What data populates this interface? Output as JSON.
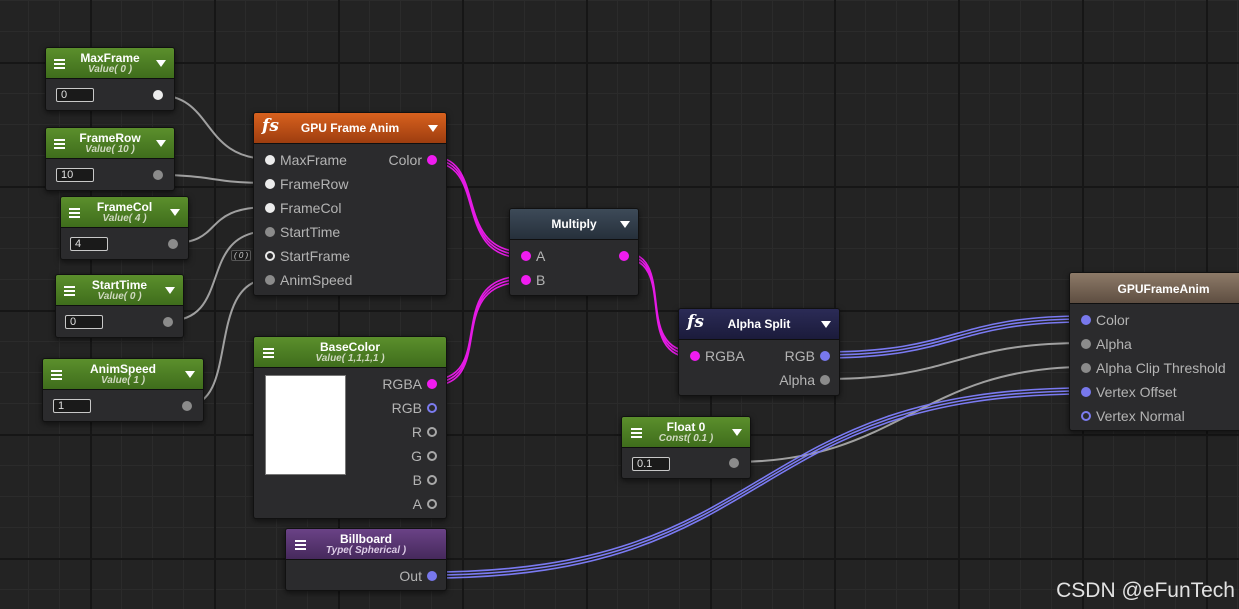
{
  "nodes": {
    "maxframe": {
      "title": "MaxFrame",
      "subtitle": "Value( 0 )",
      "value": "0"
    },
    "framerow": {
      "title": "FrameRow",
      "subtitle": "Value( 10 )",
      "value": "10"
    },
    "framecol": {
      "title": "FrameCol",
      "subtitle": "Value( 4 )",
      "value": "4"
    },
    "starttime": {
      "title": "StartTime",
      "subtitle": "Value( 0 )",
      "value": "0"
    },
    "animspeed": {
      "title": "AnimSpeed",
      "subtitle": "Value( 1 )",
      "value": "1"
    },
    "gpu_frame_anim": {
      "title": "GPU Frame Anim",
      "inputs": [
        "MaxFrame",
        "FrameRow",
        "FrameCol",
        "StartTime",
        "StartFrame",
        "AnimSpeed"
      ],
      "output": "Color",
      "startframe_default": "( 0 )"
    },
    "basecolor": {
      "title": "BaseColor",
      "subtitle": "Value( 1,1,1,1 )",
      "outputs": [
        "RGBA",
        "RGB",
        "R",
        "G",
        "B",
        "A"
      ]
    },
    "multiply": {
      "title": "Multiply",
      "inputs": [
        "A",
        "B"
      ]
    },
    "alpha_split": {
      "title": "Alpha Split",
      "input": "RGBA",
      "outputs": [
        "RGB",
        "Alpha"
      ]
    },
    "float0": {
      "title": "Float 0",
      "subtitle": "Const( 0.1 )",
      "value": "0.1"
    },
    "billboard": {
      "title": "Billboard",
      "subtitle": "Type( Spherical )",
      "output": "Out"
    },
    "output": {
      "title": "GPUFrameAnim",
      "inputs": [
        "Color",
        "Alpha",
        "Alpha Clip Threshold",
        "Vertex Offset",
        "Vertex Normal"
      ]
    }
  },
  "icons": {
    "menu": "menu-icon",
    "dropdown": "chevron-down-icon",
    "function": "function-icon"
  },
  "colors": {
    "background": "#232323",
    "node_body": "#2b2b2d",
    "property_header": "#4c7d23",
    "function_header": "#c8561a",
    "operator_header": "#323c48",
    "split_header": "#23234a",
    "billboard_header": "#5a3874",
    "output_header": "#7a6858",
    "port_color": "#f01cf0",
    "port_vector": "#7878ec",
    "port_float": "#8b8b8b",
    "port_int": "#ececec"
  },
  "watermark": "CSDN @eFunTech"
}
